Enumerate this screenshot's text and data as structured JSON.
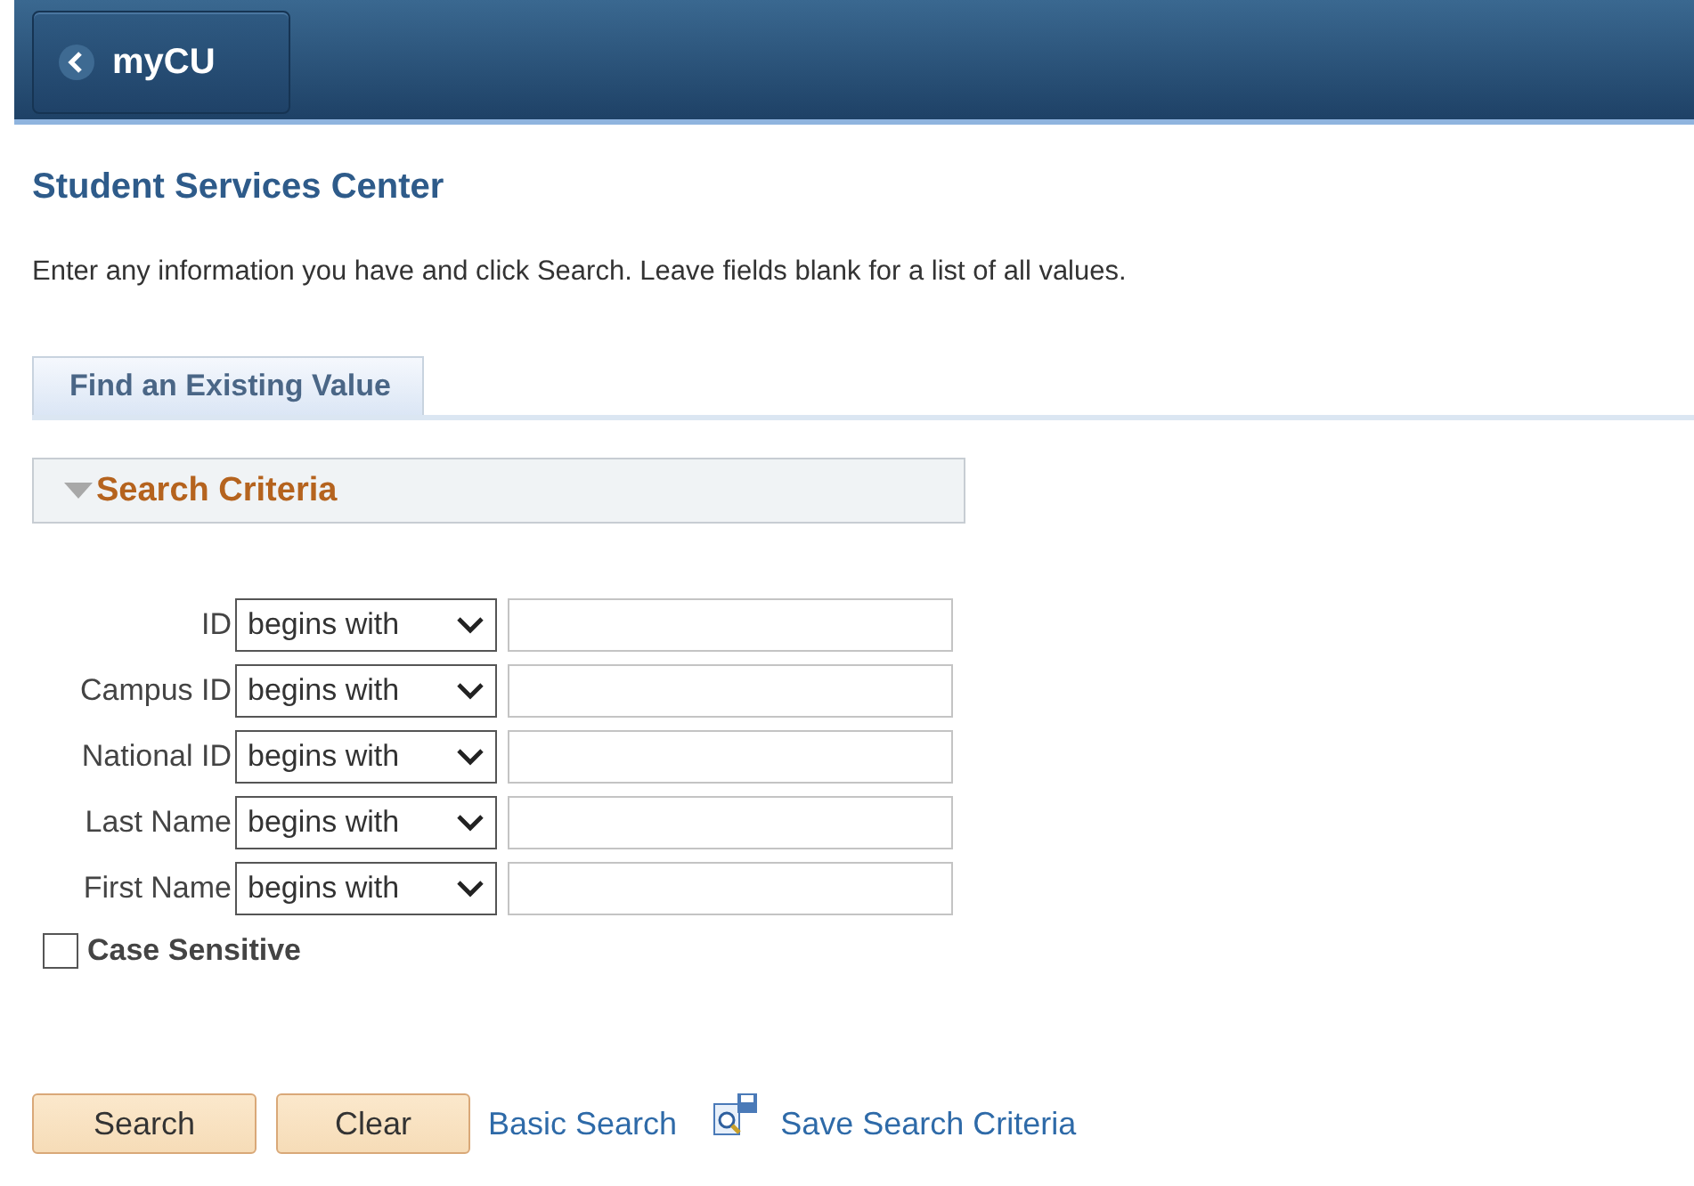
{
  "header": {
    "back_button": "myCU"
  },
  "page_title": "Student Services Center",
  "instructions": "Enter any information you have and click Search. Leave fields blank for a list of all values.",
  "tabs": [
    {
      "label": "Find an Existing Value",
      "selected": true
    }
  ],
  "search_criteria": {
    "title": "Search Criteria",
    "expanded": true
  },
  "fields": [
    {
      "label": "ID",
      "operator": "begins with"
    },
    {
      "label": "Campus ID",
      "operator": "begins with"
    },
    {
      "label": "National ID",
      "operator": "begins with"
    },
    {
      "label": "Last Name",
      "operator": "begins with"
    },
    {
      "label": "First Name",
      "operator": "begins with"
    }
  ],
  "case_sensitive": {
    "label": "Case Sensitive",
    "checked": false
  },
  "buttons": [
    "Search",
    "Clear"
  ],
  "links": {
    "basic_search": "Basic Search",
    "save_search": "Save Search Criteria"
  }
}
